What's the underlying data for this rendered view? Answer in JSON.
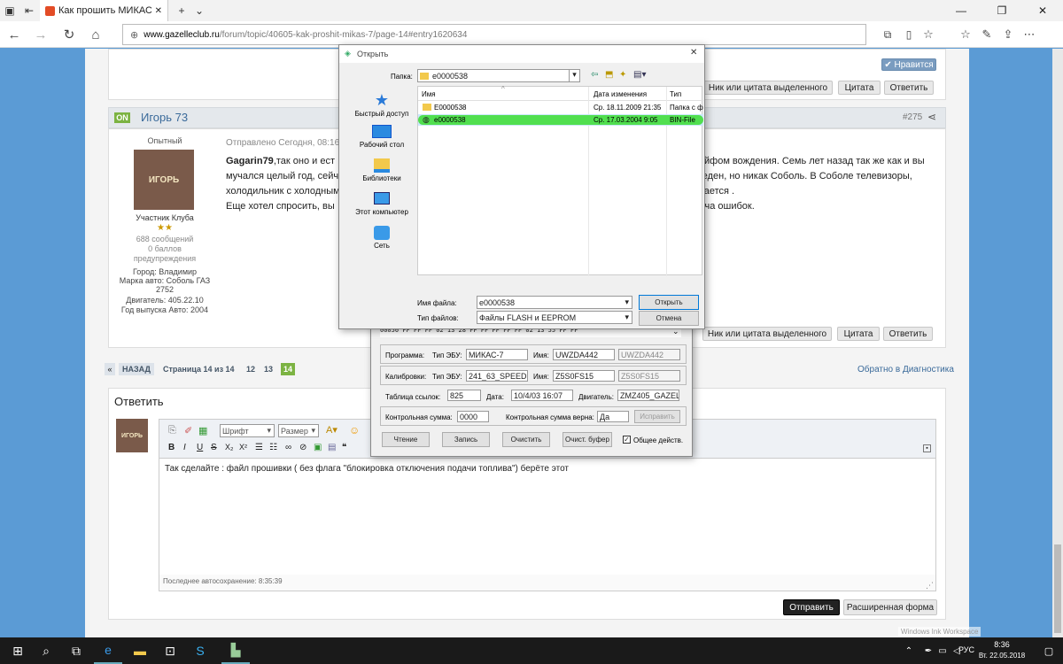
{
  "browser": {
    "tab_title": "Как прошить МИКАС-7",
    "url_domain": "www.gazelleclub.ru",
    "url_path": "/forum/topic/40605-kak-proshit-mikas-7/page-14#entry1620634"
  },
  "post_top": {
    "like": "Нравится",
    "btn_quote_sel": "Ник или цитата выделенного",
    "btn_quote": "Цитата",
    "btn_reply": "Ответить"
  },
  "post": {
    "online": "ON",
    "author": "Игорь 73",
    "post_num": "#275",
    "rank": "Опытный",
    "avatar_text": "ИГОРЬ",
    "group": "Участник Клуба",
    "stars": "★★",
    "messages": "688 сообщений",
    "points": "0 баллов",
    "warnings": "предупреждения",
    "city": "Город: Владимир",
    "car": "Марка авто: Соболь ГАЗ 2752",
    "engine": "Двигатель: 405.22.10",
    "year": "Год выпуска Авто: 2004",
    "sent": "Отправлено Сегодня, 08:16",
    "text1_name": "Gagarin79",
    "text1_rest": ",так оно и ест",
    "text1_right": "йфом вождения. Семь лет назад так же как и вы",
    "text2": "мучался целый год, сейч",
    "text2_right": "веден, но никак Соболь. В Соболе телевизоры,",
    "text3": "холодильник с холодным",
    "text3_right": "вается .",
    "text4": "Еще хотел спросить, вы",
    "text4_right": "уча ошибок.",
    "btn_quote_sel": "Ник или цитата выделенного",
    "btn_quote": "Цитата",
    "btn_reply": "Ответить"
  },
  "pagination": {
    "prev": "«",
    "back": "НАЗАД",
    "page_of": "Страница 14 из 14",
    "p12": "12",
    "p13": "13",
    "p14": "14",
    "back_link": "Обратно в Диагностика"
  },
  "reply": {
    "title": "Ответить",
    "avatar_text": "ИГОРЬ",
    "font_sel": "Шрифт",
    "size_sel": "Размер",
    "text": "Так сделайте : файл прошивки ( без флага \"блокировка отключения подачи топлива\") берёте этот",
    "autosave": "Последнее автосохранение: 8:35:39",
    "submit": "Отправить",
    "advanced": "Расширенная форма"
  },
  "open_dialog": {
    "title": "Открыть",
    "folder_label": "Папка:",
    "folder": "e0000538",
    "sidebar": [
      "Быстрый доступ",
      "Рабочий стол",
      "Библиотеки",
      "Этот компьютер",
      "Сеть"
    ],
    "col_name": "Имя",
    "col_date": "Дата изменения",
    "col_type": "Тип",
    "files": [
      {
        "name": "E0000538",
        "date": "Ср. 18.11.2009 21:35",
        "type": "Папка с ф"
      },
      {
        "name": "e0000538",
        "date": "Ср. 17.03.2004 9:05",
        "type": "BIN-File"
      }
    ],
    "filename_label": "Имя файла:",
    "filename": "e0000538",
    "filetype_label": "Тип файлов:",
    "filetype": "Файлы FLASH и EEPROM",
    "btn_open": "Открыть",
    "btn_cancel": "Отмена"
  },
  "prog": {
    "hexline": "00050 FF FF FF 02 13 28 FF FF FF FF FF 02 13 55 FF FF",
    "prog_lbl": "Программа:",
    "ecu_lbl": "Тип ЭБУ:",
    "ecu": "МИКАС-7",
    "name_lbl": "Имя:",
    "name1": "UWZDA442",
    "name2": "UWZDA442",
    "calib_lbl": "Калибровки:",
    "ecu2_lbl": "Тип ЭБУ:",
    "ecu2": "241_63_SPEED",
    "name2_lbl": "Имя:",
    "cname1": "Z5S0FS15",
    "cname2": "Z5S0FS15",
    "tbl_lbl": "Таблица ссылок:",
    "tbl": "825",
    "date_lbl": "Дата:",
    "date": "10/4/03 16:07",
    "eng_lbl": "Двигатель:",
    "eng": "ZMZ405_GAZEL",
    "cs_lbl": "Контрольная сумма:",
    "cs": "0000",
    "csok_lbl": "Контрольная сумма верна:",
    "csok": "Да",
    "fix": "Исправить",
    "read": "Чтение",
    "write": "Запись",
    "clear": "Очистить",
    "clearbuf": "Очист. буфер",
    "common": "Общее действ."
  },
  "watermark": "Windows Ink Workspace",
  "tray": {
    "lang": "РУС",
    "time": "8:36",
    "date": "Вт. 22.05.2018"
  }
}
